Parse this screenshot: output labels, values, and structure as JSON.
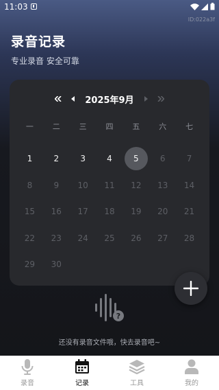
{
  "status_bar": {
    "time": "11:03"
  },
  "device_id": "ID:022a3f",
  "header": {
    "title": "录音记录",
    "subtitle": "专业录音 安全可靠"
  },
  "calendar": {
    "month_label": "2025年9月",
    "weekdays": [
      "一",
      "二",
      "三",
      "四",
      "五",
      "六",
      "七"
    ],
    "days": [
      {
        "n": "1",
        "active": true
      },
      {
        "n": "2",
        "active": true
      },
      {
        "n": "3",
        "active": true
      },
      {
        "n": "4",
        "active": true
      },
      {
        "n": "5",
        "active": true,
        "selected": true
      },
      {
        "n": "6"
      },
      {
        "n": "7"
      },
      {
        "n": "8"
      },
      {
        "n": "9"
      },
      {
        "n": "10"
      },
      {
        "n": "11"
      },
      {
        "n": "12"
      },
      {
        "n": "13"
      },
      {
        "n": "14"
      },
      {
        "n": "15"
      },
      {
        "n": "16"
      },
      {
        "n": "17"
      },
      {
        "n": "18"
      },
      {
        "n": "19"
      },
      {
        "n": "20"
      },
      {
        "n": "21"
      },
      {
        "n": "22"
      },
      {
        "n": "23"
      },
      {
        "n": "24"
      },
      {
        "n": "25"
      },
      {
        "n": "26"
      },
      {
        "n": "27"
      },
      {
        "n": "28"
      },
      {
        "n": "29"
      },
      {
        "n": "30"
      }
    ],
    "icons": {
      "prev_year": "double-chevron-left-icon",
      "prev_month": "caret-left-icon",
      "next_month": "caret-right-icon",
      "next_year": "double-chevron-right-icon"
    }
  },
  "empty_state": {
    "text": "还没有录音文件哦，快去录音吧~",
    "icon": "sound-wave-question-icon"
  },
  "fab": {
    "icon": "plus-icon"
  },
  "tabs": [
    {
      "label": "录音",
      "icon": "microphone-icon",
      "active": false
    },
    {
      "label": "记录",
      "icon": "calendar-icon",
      "active": true
    },
    {
      "label": "工具",
      "icon": "layers-icon",
      "active": false
    },
    {
      "label": "我的",
      "icon": "user-icon",
      "active": false
    }
  ],
  "colors": {
    "card": "#28292d",
    "selected_day": "#56585e",
    "active_tab": "#111111",
    "inactive_tab": "#9a9a9a"
  }
}
